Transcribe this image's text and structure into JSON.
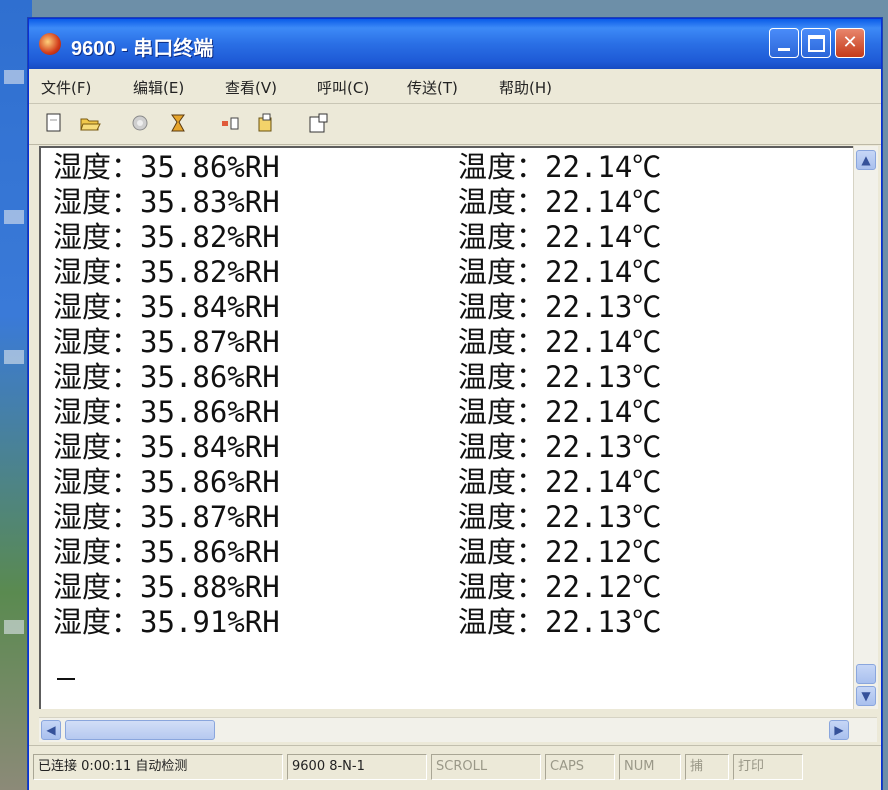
{
  "window": {
    "title": "9600 - 串口终端"
  },
  "menu": [
    "文件(F)",
    "编辑(E)",
    "查看(V)",
    "呼叫(C)",
    "传送(T)",
    "帮助(H)"
  ],
  "toolbar": [
    "new-icon",
    "open-icon",
    "properties-icon",
    "disconnect-icon",
    "send-icon",
    "receive-icon",
    "paste-icon"
  ],
  "readings": [
    {
      "humidity": "湿度：35.86%RH",
      "temperature": "温度：22.14℃"
    },
    {
      "humidity": "湿度：35.83%RH",
      "temperature": "温度：22.14℃"
    },
    {
      "humidity": "湿度：35.82%RH",
      "temperature": "温度：22.14℃"
    },
    {
      "humidity": "湿度：35.82%RH",
      "temperature": "温度：22.14℃"
    },
    {
      "humidity": "湿度：35.84%RH",
      "temperature": "温度：22.13℃"
    },
    {
      "humidity": "湿度：35.87%RH",
      "temperature": "温度：22.14℃"
    },
    {
      "humidity": "湿度：35.86%RH",
      "temperature": "温度：22.13℃"
    },
    {
      "humidity": "湿度：35.86%RH",
      "temperature": "温度：22.14℃"
    },
    {
      "humidity": "湿度：35.84%RH",
      "temperature": "温度：22.13℃"
    },
    {
      "humidity": "湿度：35.86%RH",
      "temperature": "温度：22.14℃"
    },
    {
      "humidity": "湿度：35.87%RH",
      "temperature": "温度：22.13℃"
    },
    {
      "humidity": "湿度：35.86%RH",
      "temperature": "温度：22.12℃"
    },
    {
      "humidity": "湿度：35.88%RH",
      "temperature": "温度：22.12℃"
    },
    {
      "humidity": "湿度：35.91%RH",
      "temperature": "温度：22.13℃"
    }
  ],
  "status": {
    "connected": "已连接 0:00:11 自动检测",
    "port": "9600 8-N-1",
    "scroll": "SCROLL",
    "caps": "CAPS",
    "num": "NUM",
    "capture": "捕",
    "print": "打印"
  },
  "colors": {
    "titlebar": "#2a6fe5",
    "close_button": "#c43a1a",
    "window_bg": "#ece9d8"
  }
}
